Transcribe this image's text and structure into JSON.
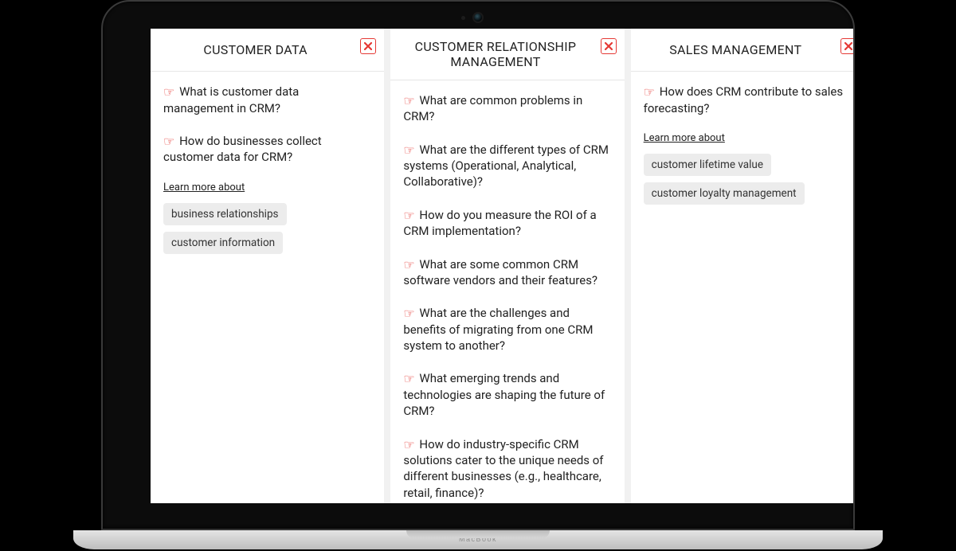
{
  "device_label": "MacBook",
  "learn_more_label": "Learn more about",
  "columns": [
    {
      "title": "CUSTOMER DATA",
      "questions": [
        "What is customer data management in CRM?",
        "How do businesses collect customer data for CRM?"
      ],
      "tags": [
        "business relationships",
        "customer information"
      ]
    },
    {
      "title": "CUSTOMER RELATIONSHIP MANAGEMENT",
      "questions": [
        "What are common problems in CRM?",
        "What are the different types of CRM systems (Operational, Analytical, Collaborative)?",
        "How do you measure the ROI of a CRM implementation?",
        "What are some common CRM software vendors and their features?",
        "What are the challenges and benefits of migrating from one CRM system to another?",
        "What emerging trends and technologies are shaping the future of CRM?",
        "How do industry-specific CRM solutions cater to the unique needs of different businesses (e.g., healthcare, retail, finance)?"
      ],
      "tags": []
    },
    {
      "title": "SALES MANAGEMENT",
      "questions": [
        "How does CRM contribute to sales forecasting?"
      ],
      "tags": [
        "customer lifetime value",
        "customer loyalty management"
      ]
    }
  ]
}
